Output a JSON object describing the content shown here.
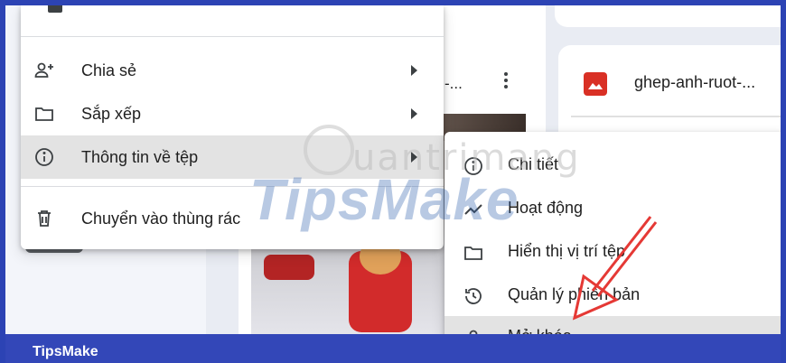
{
  "background": {
    "file1_name": "-...",
    "file2_name": "ghep-anh-ruot-..."
  },
  "menu": {
    "items": [
      {
        "label": "Chia sẻ",
        "icon": "person-add-icon",
        "has_submenu": true
      },
      {
        "label": "Sắp xếp",
        "icon": "folder-icon",
        "has_submenu": true
      },
      {
        "label": "Thông tin về tệp",
        "icon": "info-icon",
        "has_submenu": true,
        "active": true
      },
      {
        "label": "Chuyển vào thùng rác",
        "icon": "trash-icon",
        "has_submenu": false
      }
    ]
  },
  "submenu": {
    "items": [
      {
        "label": "Chi tiết",
        "icon": "info-icon"
      },
      {
        "label": "Hoạt động",
        "icon": "activity-icon"
      },
      {
        "label": "Hiển thị vị trí tệp",
        "icon": "folder-icon"
      },
      {
        "label": "Quản lý phiên bản",
        "icon": "history-icon"
      },
      {
        "label": "Mở khóa",
        "icon": "lock-icon"
      }
    ]
  },
  "watermark": {
    "main": "TipsMake",
    "secondary": "uantrimang"
  },
  "footer": {
    "brand": "TipsMake"
  },
  "colors": {
    "accent": "#3347b8",
    "arrow": "#e53935",
    "image_icon": "#d93025"
  }
}
